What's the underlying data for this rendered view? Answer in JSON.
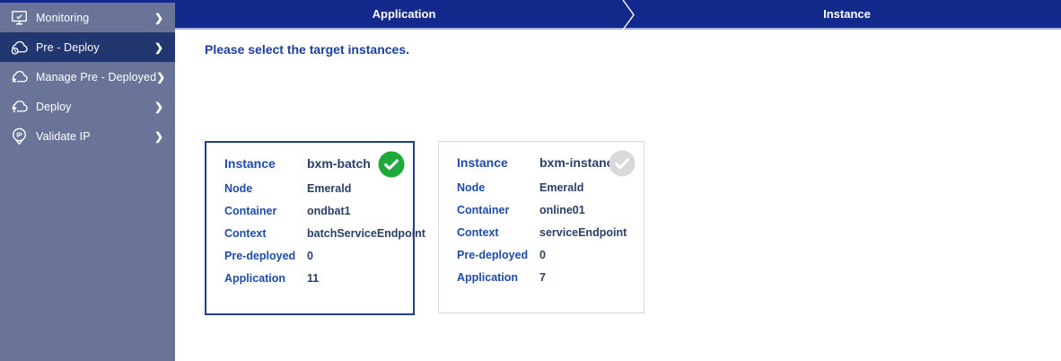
{
  "sidebar": {
    "chevron_glyph": "❯",
    "items": [
      {
        "label": "Monitoring",
        "icon": "monitor-check-icon",
        "selected": false
      },
      {
        "label": "Pre - Deploy",
        "icon": "cloud-gauge-icon",
        "selected": true
      },
      {
        "label": "Manage Pre - Deployed",
        "icon": "cloud-remove-icon",
        "selected": false
      },
      {
        "label": "Deploy",
        "icon": "cloud-upload-icon",
        "selected": false
      },
      {
        "label": "Validate IP",
        "icon": "ip-pin-icon",
        "selected": false
      }
    ]
  },
  "stepper": {
    "steps": [
      {
        "label": "Application"
      },
      {
        "label": "Instance"
      }
    ]
  },
  "content": {
    "heading": "Please select the target instances."
  },
  "cards": [
    {
      "selected": true,
      "check_icon": "check-circle-icon",
      "check_state": "selected",
      "rows": [
        {
          "label": "Instance",
          "value": "bxm-batch"
        },
        {
          "label": "Node",
          "value": "Emerald"
        },
        {
          "label": "Container",
          "value": "ondbat1"
        },
        {
          "label": "Context",
          "value": "batchServiceEndpoint"
        },
        {
          "label": "Pre-deployed",
          "value": "0"
        },
        {
          "label": "Application",
          "value": "11"
        }
      ]
    },
    {
      "selected": false,
      "check_icon": "check-circle-icon",
      "check_state": "unselected",
      "rows": [
        {
          "label": "Instance",
          "value": "bxm-instance"
        },
        {
          "label": "Node",
          "value": "Emerald"
        },
        {
          "label": "Container",
          "value": "online01"
        },
        {
          "label": "Context",
          "value": "serviceEndpoint"
        },
        {
          "label": "Pre-deployed",
          "value": "0"
        },
        {
          "label": "Application",
          "value": "7"
        }
      ]
    }
  ],
  "colors": {
    "sidebar_bg": "#6A7499",
    "sidebar_selected_bg": "#223670",
    "stepper_bg": "#13298C",
    "stepper_underline": "#A8B1DB",
    "heading_text": "#1C3FA0",
    "card_selected_border": "#1F3D8C",
    "card_border": "#D8D8D8",
    "label_text": "#1E4CA8",
    "value_text": "#2B4066",
    "check_selected": "#1FA83C",
    "check_unselected": "#D9D9D9"
  }
}
